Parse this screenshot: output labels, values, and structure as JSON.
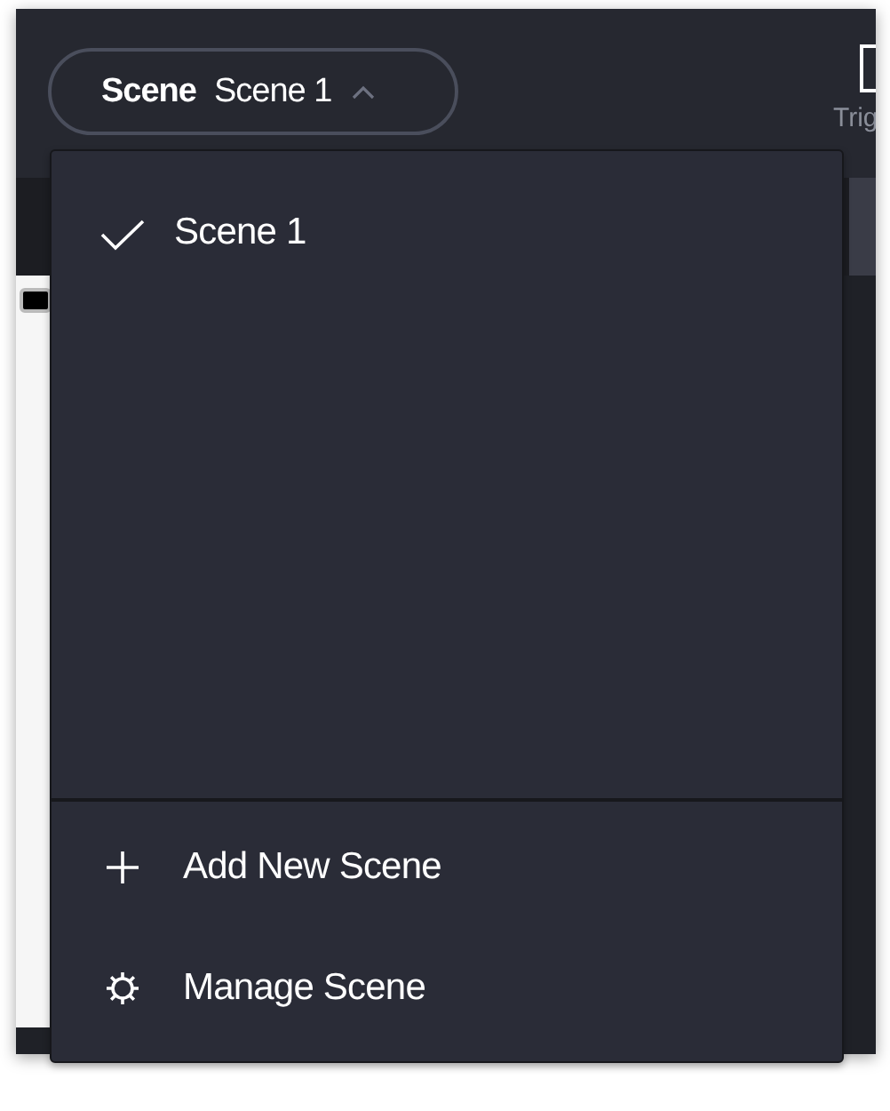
{
  "scene_selector": {
    "label": "Scene",
    "value": "Scene 1",
    "expanded": true
  },
  "toolbar_partial": {
    "label": "Trig"
  },
  "scene_menu": {
    "scenes": [
      {
        "label": "Scene 1",
        "selected": true
      }
    ],
    "actions": [
      {
        "kind": "add",
        "label": "Add New Scene"
      },
      {
        "kind": "manage",
        "label": "Manage Scene"
      }
    ]
  }
}
